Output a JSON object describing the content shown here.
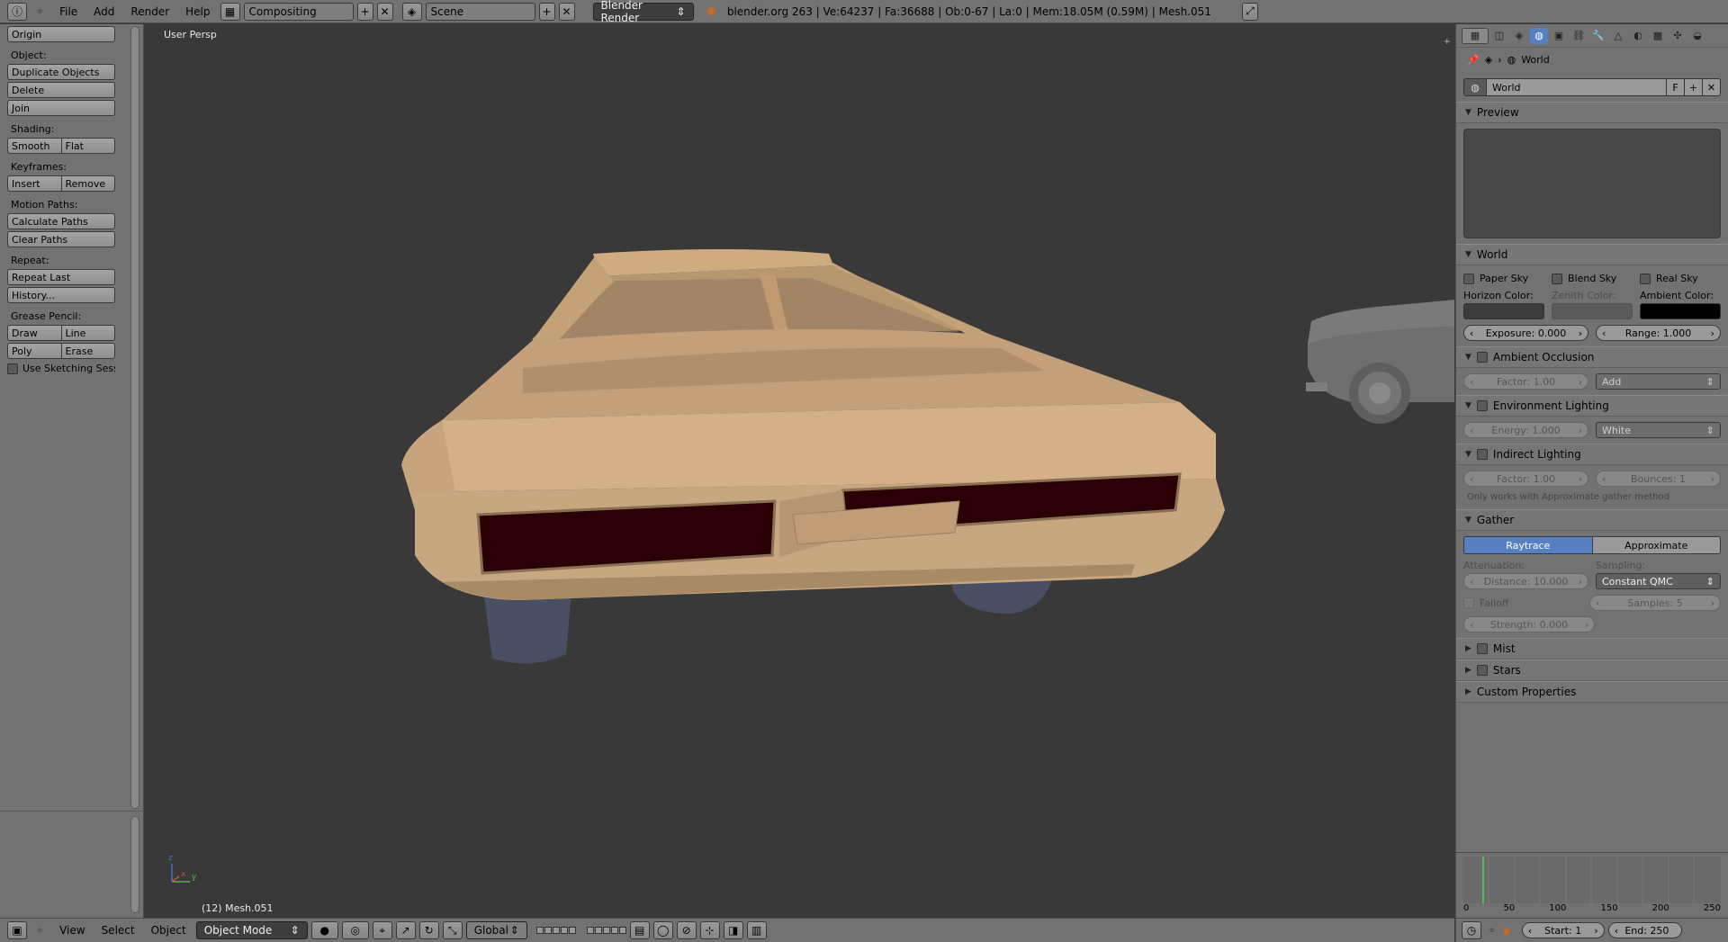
{
  "top": {
    "menus": [
      "File",
      "Add",
      "Render",
      "Help"
    ],
    "layout_name": "Compositing",
    "scene_name": "Scene",
    "engine": "Blender Render",
    "stats": "blender.org 263 | Ve:64237 | Fa:36688 | Ob:0-67 | La:0 | Mem:18.05M (0.59M) | Mesh.051"
  },
  "tools": {
    "origin": "Origin",
    "object_label": "Object:",
    "duplicate": "Duplicate Objects",
    "delete": "Delete",
    "join": "Join",
    "shading_label": "Shading:",
    "smooth": "Smooth",
    "flat": "Flat",
    "keyframes_label": "Keyframes:",
    "insert": "Insert",
    "remove": "Remove",
    "motion_label": "Motion Paths:",
    "calc_paths": "Calculate Paths",
    "clear_paths": "Clear Paths",
    "repeat_label": "Repeat:",
    "repeat_last": "Repeat Last",
    "history": "History...",
    "grease_label": "Grease Pencil:",
    "draw": "Draw",
    "line": "Line",
    "poly": "Poly",
    "erase": "Erase",
    "sketching": "Use Sketching Sessio"
  },
  "viewport": {
    "view_name": "User Persp",
    "object_info": "(12) Mesh.051",
    "axis_x": "x",
    "axis_y": "y",
    "axis_z": "z"
  },
  "bottom": {
    "menus": [
      "View",
      "Select",
      "Object"
    ],
    "mode": "Object Mode",
    "orientation": "Global"
  },
  "props": {
    "context_world": "World",
    "world_datablock": "World",
    "fake_user": "F",
    "preview_title": "Preview",
    "world_panel": "World",
    "paper_sky": "Paper Sky",
    "blend_sky": "Blend Sky",
    "real_sky": "Real Sky",
    "horizon_label": "Horizon Color:",
    "zenith_label": "Zenith Color:",
    "ambient_label": "Ambient Color:",
    "horizon_color": "#3c3c3c",
    "zenith_color": "#5a5a5a",
    "ambient_color": "#000000",
    "exposure": "Exposure: 0.000",
    "range": "Range: 1.000",
    "ao_panel": "Ambient Occlusion",
    "ao_factor": "Factor: 1.00",
    "ao_blend": "Add",
    "env_panel": "Environment Lighting",
    "env_energy": "Energy: 1.000",
    "env_color": "White",
    "indirect_panel": "Indirect Lighting",
    "indirect_factor": "Factor: 1.00",
    "indirect_bounces": "Bounces: 1",
    "indirect_note": "Only works with Approximate gather method",
    "gather_panel": "Gather",
    "raytrace": "Raytrace",
    "approximate": "Approximate",
    "attenuation_label": "Attenuation:",
    "sampling_label": "Sampling:",
    "distance": "Distance: 10.000",
    "sampling_method": "Constant QMC",
    "falloff": "Falloff",
    "samples": "Samples: 5",
    "strength": "Strength: 0.000",
    "mist_panel": "Mist",
    "stars_panel": "Stars",
    "custom_panel": "Custom Properties"
  },
  "timeline": {
    "ticks": [
      "0",
      "50",
      "100",
      "150",
      "200",
      "250"
    ],
    "start": "Start: 1",
    "end": "End: 250"
  },
  "colors": {
    "accent": "#5680c2",
    "car_body": "#c9a57a",
    "taillight": "#2a0006",
    "current_frame": "#4fc04f"
  }
}
